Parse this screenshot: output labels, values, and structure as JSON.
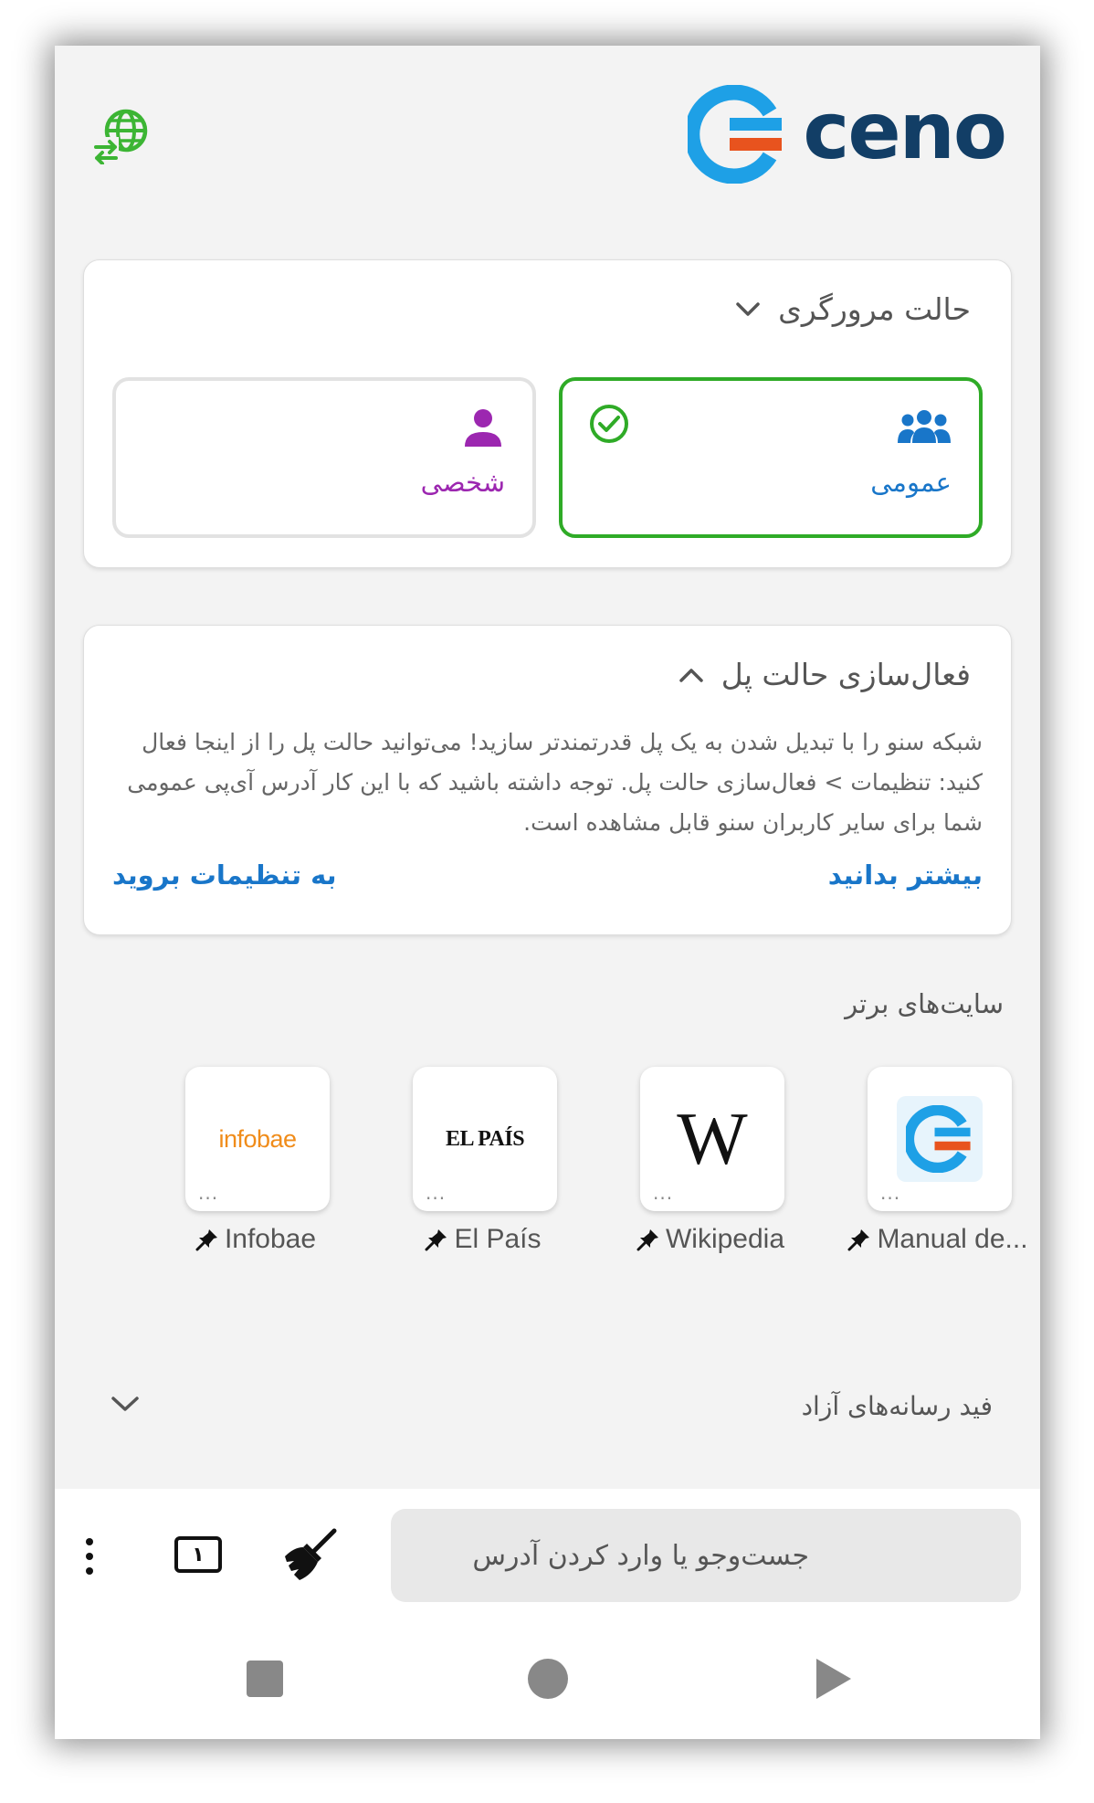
{
  "brand": {
    "name": "ceno",
    "colors": {
      "blue": "#1ea0e6",
      "navy": "#123e66",
      "orange": "#e8531e",
      "green": "#2fab27",
      "purple": "#9c27b0",
      "link": "#1976c9"
    }
  },
  "header": {
    "language_icon": "globe-swap-icon"
  },
  "browsing_mode": {
    "title": "حالت مرورگری",
    "options": [
      {
        "label": "عمومی",
        "icon": "group-icon",
        "selected": true
      },
      {
        "label": "شخصی",
        "icon": "person-icon",
        "selected": false
      }
    ]
  },
  "bridge": {
    "title": "فعال‌سازی حالت پل",
    "body": "شبکه سنو را با تبدیل شدن به یک پل قدرتمندتر سازید! می‌توانید حالت پل را از اینجا فعال کنید: تنظیمات > فعال‌سازی حالت پل. توجه داشته باشید که با این کار آدرس آی‌پی عمومی شما برای سایر کاربران سنو قابل مشاهده است.",
    "learn_more": "بیشتر بدانید",
    "go_to_settings": "به تنظیمات بروید"
  },
  "top_sites": {
    "title": "سایت‌های برتر",
    "more_dots": "...",
    "sites": [
      {
        "label": "Manual de...",
        "logo": "ceno-logo",
        "pinned": true
      },
      {
        "label": "Wikipedia",
        "logo_text": "W",
        "pinned": true
      },
      {
        "label": "El País",
        "logo_text": "EL PAÍS",
        "pinned": true
      },
      {
        "label": "Infobae",
        "logo_text": "infobae",
        "pinned": true
      }
    ]
  },
  "feed": {
    "title": "فید رسانه‌های آزاد"
  },
  "toolbar": {
    "url_placeholder": "جست‌وجو یا وارد کردن آدرس",
    "tab_count": "۱",
    "clear_icon": "broom-icon",
    "menu_icon": "more-vertical-icon"
  },
  "android_nav": {
    "buttons": [
      "recents",
      "home",
      "back"
    ]
  }
}
